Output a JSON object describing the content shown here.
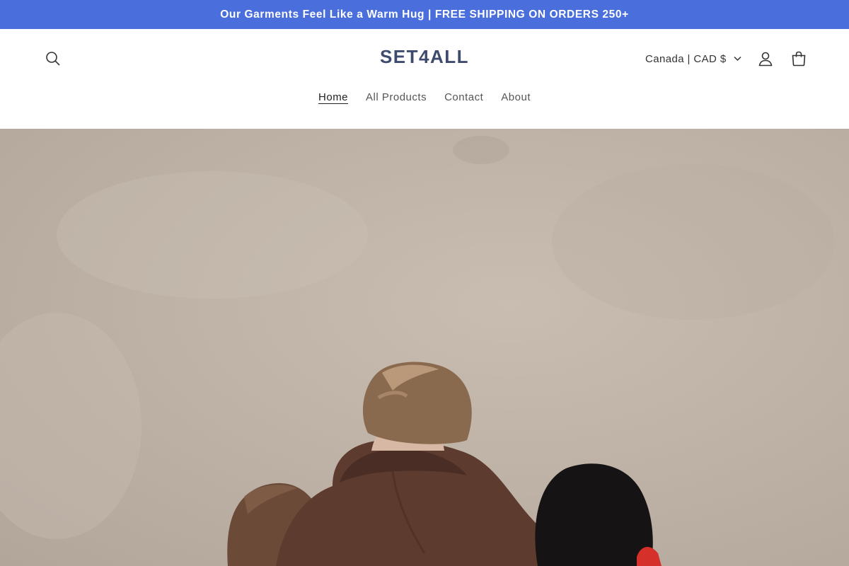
{
  "announcement": {
    "text": "Our Garments Feel Like a Warm Hug | FREE SHIPPING ON ORDERS 250+"
  },
  "header": {
    "logo": "SET4ALL",
    "locale": "Canada | CAD $",
    "icons": {
      "search": "search-icon",
      "account": "user-icon",
      "cart": "cart-icon",
      "locale_caret": "chevron-down-icon"
    }
  },
  "nav": {
    "items": [
      {
        "label": "Home",
        "active": true
      },
      {
        "label": "All Products",
        "active": false
      },
      {
        "label": "Contact",
        "active": false
      },
      {
        "label": "About",
        "active": false
      }
    ]
  },
  "colors": {
    "announcement_bg": "#4a6fdc",
    "logo": "#3f4b6e",
    "hero_wall": "#c3b7ab",
    "hoodie": "#5e3b2f",
    "red_garment": "#d5302a"
  }
}
